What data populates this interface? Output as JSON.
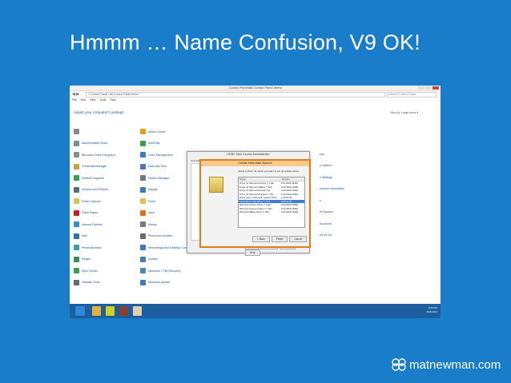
{
  "slide": {
    "title": "Hmmm … Name Confusion, V9 OK!",
    "brand": "matnewman.com"
  },
  "window": {
    "title": "Control Panel\\All Control Panel Items",
    "address": "« Control Panel › All Control Panel Items",
    "search_placeholder": "Search Control Panel",
    "menu": [
      "File",
      "Edit",
      "View",
      "Tools",
      "Help"
    ],
    "heading": "Adjust your computer's settings",
    "view_by": "View by:  Large icons ▾"
  },
  "control_panel_items": [
    {
      "label": "",
      "color": "#8a8a8a"
    },
    {
      "label": "Action Center",
      "color": "#e0a020"
    },
    {
      "label": "Administrative Tools",
      "color": "#7a8ea0"
    },
    {
      "label": "AutoPlay",
      "color": "#3aa050"
    },
    {
      "label": "BitLocker Drive Encryption",
      "color": "#8a8a8a"
    },
    {
      "label": "Color Management",
      "color": "#3c78c8"
    },
    {
      "label": "Credential Manager",
      "color": "#d0a040"
    },
    {
      "label": "Date and Time",
      "color": "#4a7ab0"
    },
    {
      "label": "Default Programs",
      "color": "#3aa050"
    },
    {
      "label": "Device Manager",
      "color": "#6a7a8a"
    },
    {
      "label": "Devices and Printers",
      "color": "#5a6a7a"
    },
    {
      "label": "Display",
      "color": "#3a7ac0"
    },
    {
      "label": "Folder Options",
      "color": "#e0c050"
    },
    {
      "label": "Fonts",
      "color": "#e0c050"
    },
    {
      "label": "Flash Player",
      "color": "#c02020"
    },
    {
      "label": "Java",
      "color": "#e07020"
    },
    {
      "label": "Internet Options",
      "color": "#3a8ad0"
    },
    {
      "label": "Mouse",
      "color": "#7a7a7a"
    },
    {
      "label": "Mail",
      "color": "#3a6ab0"
    },
    {
      "label": "Phone and Modem",
      "color": "#6a6a6a"
    },
    {
      "label": "Personalization",
      "color": "#3aa0a0"
    },
    {
      "label": "RemoteApp and Desktop Connections",
      "color": "#3a7ac0"
    },
    {
      "label": "Region",
      "color": "#3a8a5a"
    },
    {
      "label": "System",
      "color": "#4a7ab0"
    },
    {
      "label": "Sync Center",
      "color": "#3aa050"
    },
    {
      "label": "Windows 7 File Recovery",
      "color": "#4a8ab0"
    },
    {
      "label": "VMware Tools",
      "color": "#6a6a6a"
    },
    {
      "label": "Windows Update",
      "color": "#3a7ac0"
    }
  ],
  "right_column_partial": [
    {
      "label": "tory"
    },
    {
      "label": "y Options"
    },
    {
      "label": "n Settings"
    },
    {
      "label": "rmance Information"
    },
    {
      "label": "s"
    },
    {
      "label": "ch Spaces"
    },
    {
      "label": "Accounts"
    },
    {
      "label": "ws To Go"
    }
  ],
  "odbc_dialog": {
    "title": "ODBC Data Source Administrator",
    "tab": "User DSN",
    "buttons": [
      "OK",
      "Cancel",
      "Apply",
      "Help"
    ]
  },
  "create_dialog": {
    "title": "Create New Data Source",
    "prompt": "Select a driver for which you want to set up a data source.",
    "columns": [
      "Name",
      "Version"
    ],
    "drivers": [
      {
        "name": "Driver do Microsoft Access (*.mdb)",
        "version": "6.02.9200.16384",
        "selected": false
      },
      {
        "name": "Driver do Microsoft dBase (*.dbf)",
        "version": "6.02.9200.16384",
        "selected": false
      },
      {
        "name": "Driver do Microsoft Excel(*.xls)",
        "version": "6.02.9200.16384",
        "selected": false
      },
      {
        "name": "Driver do Microsoft Paradox (*.db)",
        "version": "6.02.9200.16384",
        "selected": false
      },
      {
        "name": "Driver para o Microsoft Visual FoxPro",
        "version": "1.00.02.00",
        "selected": false
      },
      {
        "name": "Lotus Notes SQL Driver (*.nsf)",
        "version": "9.00.00.00",
        "selected": true
      },
      {
        "name": "Microsoft Access Driver (*.mdb)",
        "version": "6.02.9200.16384",
        "selected": false
      },
      {
        "name": "Microsoft Access-Treiber (*.mdb)",
        "version": "6.02.9200.16384",
        "selected": false
      },
      {
        "name": "Microsoft dBase Driver (*.dbf)",
        "version": "6.02.9200.16384",
        "selected": false
      }
    ],
    "buttons": [
      "< Back",
      "Finish",
      "Cancel"
    ]
  },
  "taskbar": {
    "time": "2:53 PM",
    "date": "2/26/2013",
    "icons": [
      {
        "name": "file-explorer-icon",
        "color": "#e0b040"
      },
      {
        "name": "lotus-notes-icon",
        "color": "#d0d020"
      },
      {
        "name": "notes-designer-icon",
        "color": "#8a4030"
      },
      {
        "name": "odbc-icon",
        "color": "#e0d0b0"
      }
    ]
  }
}
